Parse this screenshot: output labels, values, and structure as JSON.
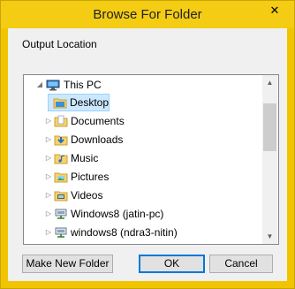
{
  "dialog": {
    "title": "Browse For Folder",
    "close_glyph": "✕",
    "description": "Output Location"
  },
  "tree": {
    "expand_glyph": "◢",
    "collapse_glyph": "▷",
    "items": [
      {
        "label": "This PC",
        "icon": "this-pc-icon",
        "expanded": true
      },
      {
        "label": "Desktop",
        "icon": "desktop-folder-icon",
        "selected": true
      },
      {
        "label": "Documents",
        "icon": "documents-folder-icon"
      },
      {
        "label": "Downloads",
        "icon": "downloads-folder-icon"
      },
      {
        "label": "Music",
        "icon": "music-folder-icon"
      },
      {
        "label": "Pictures",
        "icon": "pictures-folder-icon"
      },
      {
        "label": "Videos",
        "icon": "videos-folder-icon"
      },
      {
        "label": "Windows8 (jatin-pc)",
        "icon": "network-drive-icon"
      },
      {
        "label": "windows8 (ndra3-nitin)",
        "icon": "network-drive-icon"
      }
    ]
  },
  "scrollbar": {
    "up_glyph": "▲",
    "down_glyph": "▼"
  },
  "buttons": {
    "new_folder": "Make New Folder",
    "ok": "OK",
    "cancel": "Cancel"
  },
  "colors": {
    "titlebar": "#f4cc13",
    "selection": "#cce8ff",
    "default_button_border": "#0078d7"
  }
}
